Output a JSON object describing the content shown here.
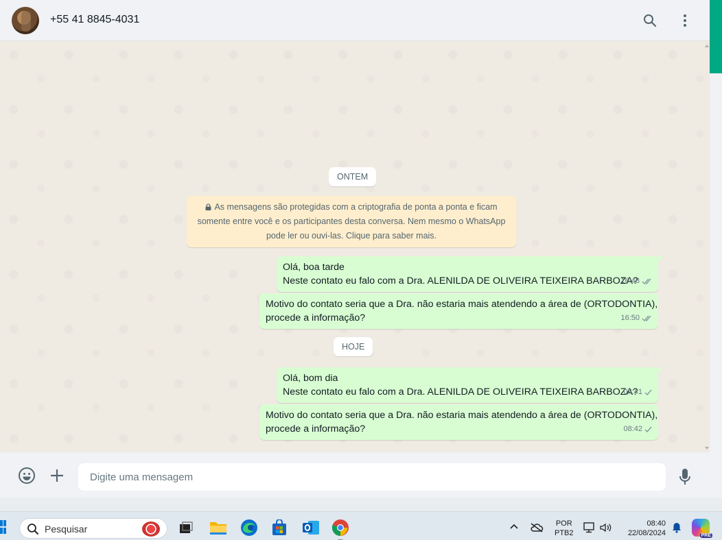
{
  "header": {
    "contact_name": "+55 41 8845-4031",
    "icons": [
      "search-icon",
      "more-vertical-icon"
    ]
  },
  "chat": {
    "date_yesterday": "ONTEM",
    "date_today": "HOJE",
    "encryption_notice": {
      "line1": "As mensagens são protegidas com a criptografia de ponta a ponta e ficam",
      "line2": "somente entre você e os participantes desta conversa. Nem mesmo o WhatsApp",
      "line3": "pode ler ou ouvi-las. Clique para saber mais."
    },
    "messages": [
      {
        "line1": "Olá, boa tarde",
        "line2": "Neste contato eu falo com a Dra. ALENILDA DE OLIVEIRA TEIXEIRA BARBOZA?",
        "time": "16:48",
        "status": "read"
      },
      {
        "line1": "Motivo do contato seria que a Dra. não estaria mais atendendo a área de (ORTODONTIA),",
        "line2": "procede a informação?",
        "time": "16:50",
        "status": "read"
      },
      {
        "line1": "Olá, bom dia",
        "line2": "Neste contato eu falo com a Dra. ALENILDA DE OLIVEIRA TEIXEIRA BARBOZA?",
        "time": "08:41",
        "status": "sent"
      },
      {
        "line1": "Motivo do contato seria que a Dra. não estaria mais atendendo a área de (ORTODONTIA),",
        "line2": "procede a informação?",
        "time": "08:42",
        "status": "sent"
      }
    ]
  },
  "composer": {
    "placeholder": "Digite uma mensagem"
  },
  "taskbar": {
    "search_label": "Pesquisar",
    "lang_top": "POR",
    "lang_bottom": "PTB2",
    "time": "08:40",
    "date": "22/08/2024",
    "copilot_badge": "PRE"
  },
  "colors": {
    "outgoing_bubble": "#d9fdd3",
    "notice_bg": "#ffeecd",
    "accent": "#00a884",
    "read_ticks": "#667781"
  }
}
